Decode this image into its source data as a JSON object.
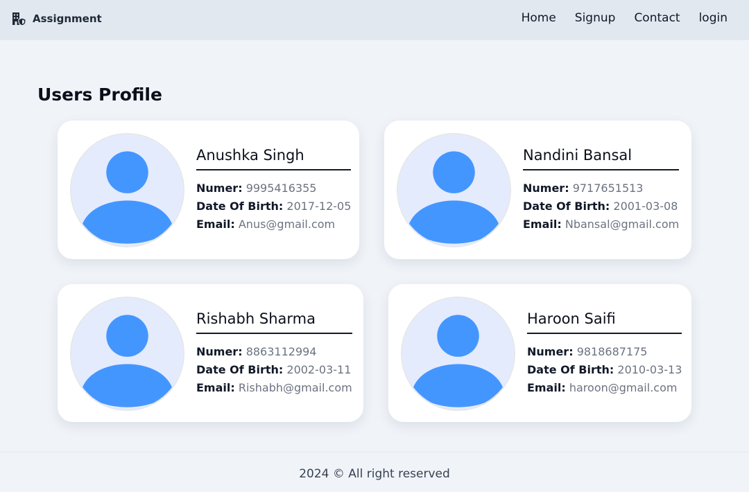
{
  "header": {
    "brand": "Assignment",
    "nav": [
      "Home",
      "Signup",
      "Contact",
      "login"
    ]
  },
  "main": {
    "title": "Users Profile",
    "labels": {
      "number": "Numer:",
      "dob": "Date Of Birth:",
      "email": "Email:"
    },
    "users": [
      {
        "name": "Anushka Singh",
        "number": "9995416355",
        "dob": "2017-12-05",
        "email": "Anus@gmail.com"
      },
      {
        "name": "Nandini Bansal",
        "number": "9717651513",
        "dob": "2001-03-08",
        "email": "Nbansal@gmail.com"
      },
      {
        "name": "Rishabh Sharma",
        "number": "8863112994",
        "dob": "2002-03-11",
        "email": "Rishabh@gmail.com"
      },
      {
        "name": "Haroon Saifi",
        "number": "9818687175",
        "dob": "2010-03-13",
        "email": "haroon@gmail.com"
      }
    ]
  },
  "footer": {
    "text": "2024 © All right reserved"
  },
  "colors": {
    "page_background": "#f0f4f9",
    "navbar_background": "#e2e8f0",
    "avatar_fill": "#4496ff",
    "avatar_background": "#e4ebfd",
    "value_text": "#6b7280"
  },
  "icons": {
    "brand": "building-shield-icon",
    "avatar": "user-avatar-icon"
  }
}
